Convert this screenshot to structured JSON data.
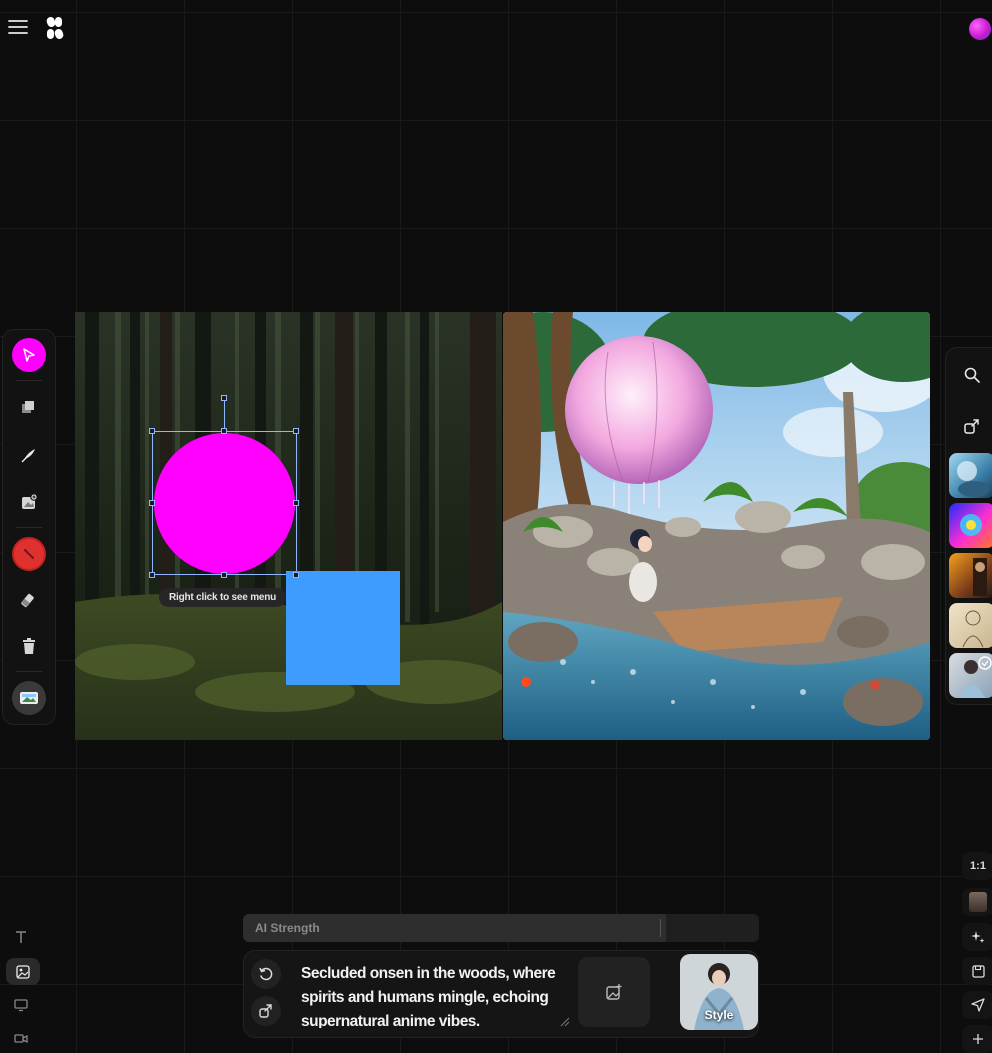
{
  "canvas": {
    "tooltip": "Right click to see menu"
  },
  "controls": {
    "ai_strength_label": "AI Strength",
    "ai_strength_value": 0.82
  },
  "prompt": {
    "text": "Secluded onsen in the woods, where spirits and humans mingle, echoing supernatural anime vibes."
  },
  "style_button": {
    "label": "Style"
  },
  "aspect_ratio": {
    "label": "1:1"
  },
  "colors": {
    "select_tool": "#ff00ff",
    "shape_circle": "#ff00ff",
    "shape_square": "#3f9cff",
    "color_picker": "#e0312f",
    "background": "#0d0d0d"
  },
  "icons": {
    "top_left": [
      "menu-icon",
      "krea-logo"
    ],
    "left_toolbar": [
      "cursor-icon",
      "layers-icon",
      "pen-icon",
      "image-add-icon",
      "color-picker-icon",
      "eraser-icon",
      "trash-icon",
      "image-icon"
    ],
    "right_panel": [
      "search-icon",
      "share-icon"
    ],
    "bottom_left": [
      "text-icon",
      "image-icon",
      "monitor-icon",
      "video-icon"
    ],
    "bottom_right": [
      "aspect-ratio-icon",
      "style-portrait-icon",
      "sparkle-icon",
      "save-icon",
      "send-icon",
      "add-icon"
    ],
    "prompt_bar": [
      "undo-icon",
      "swap-icon",
      "add-image-icon",
      "resize-grip-icon"
    ]
  }
}
